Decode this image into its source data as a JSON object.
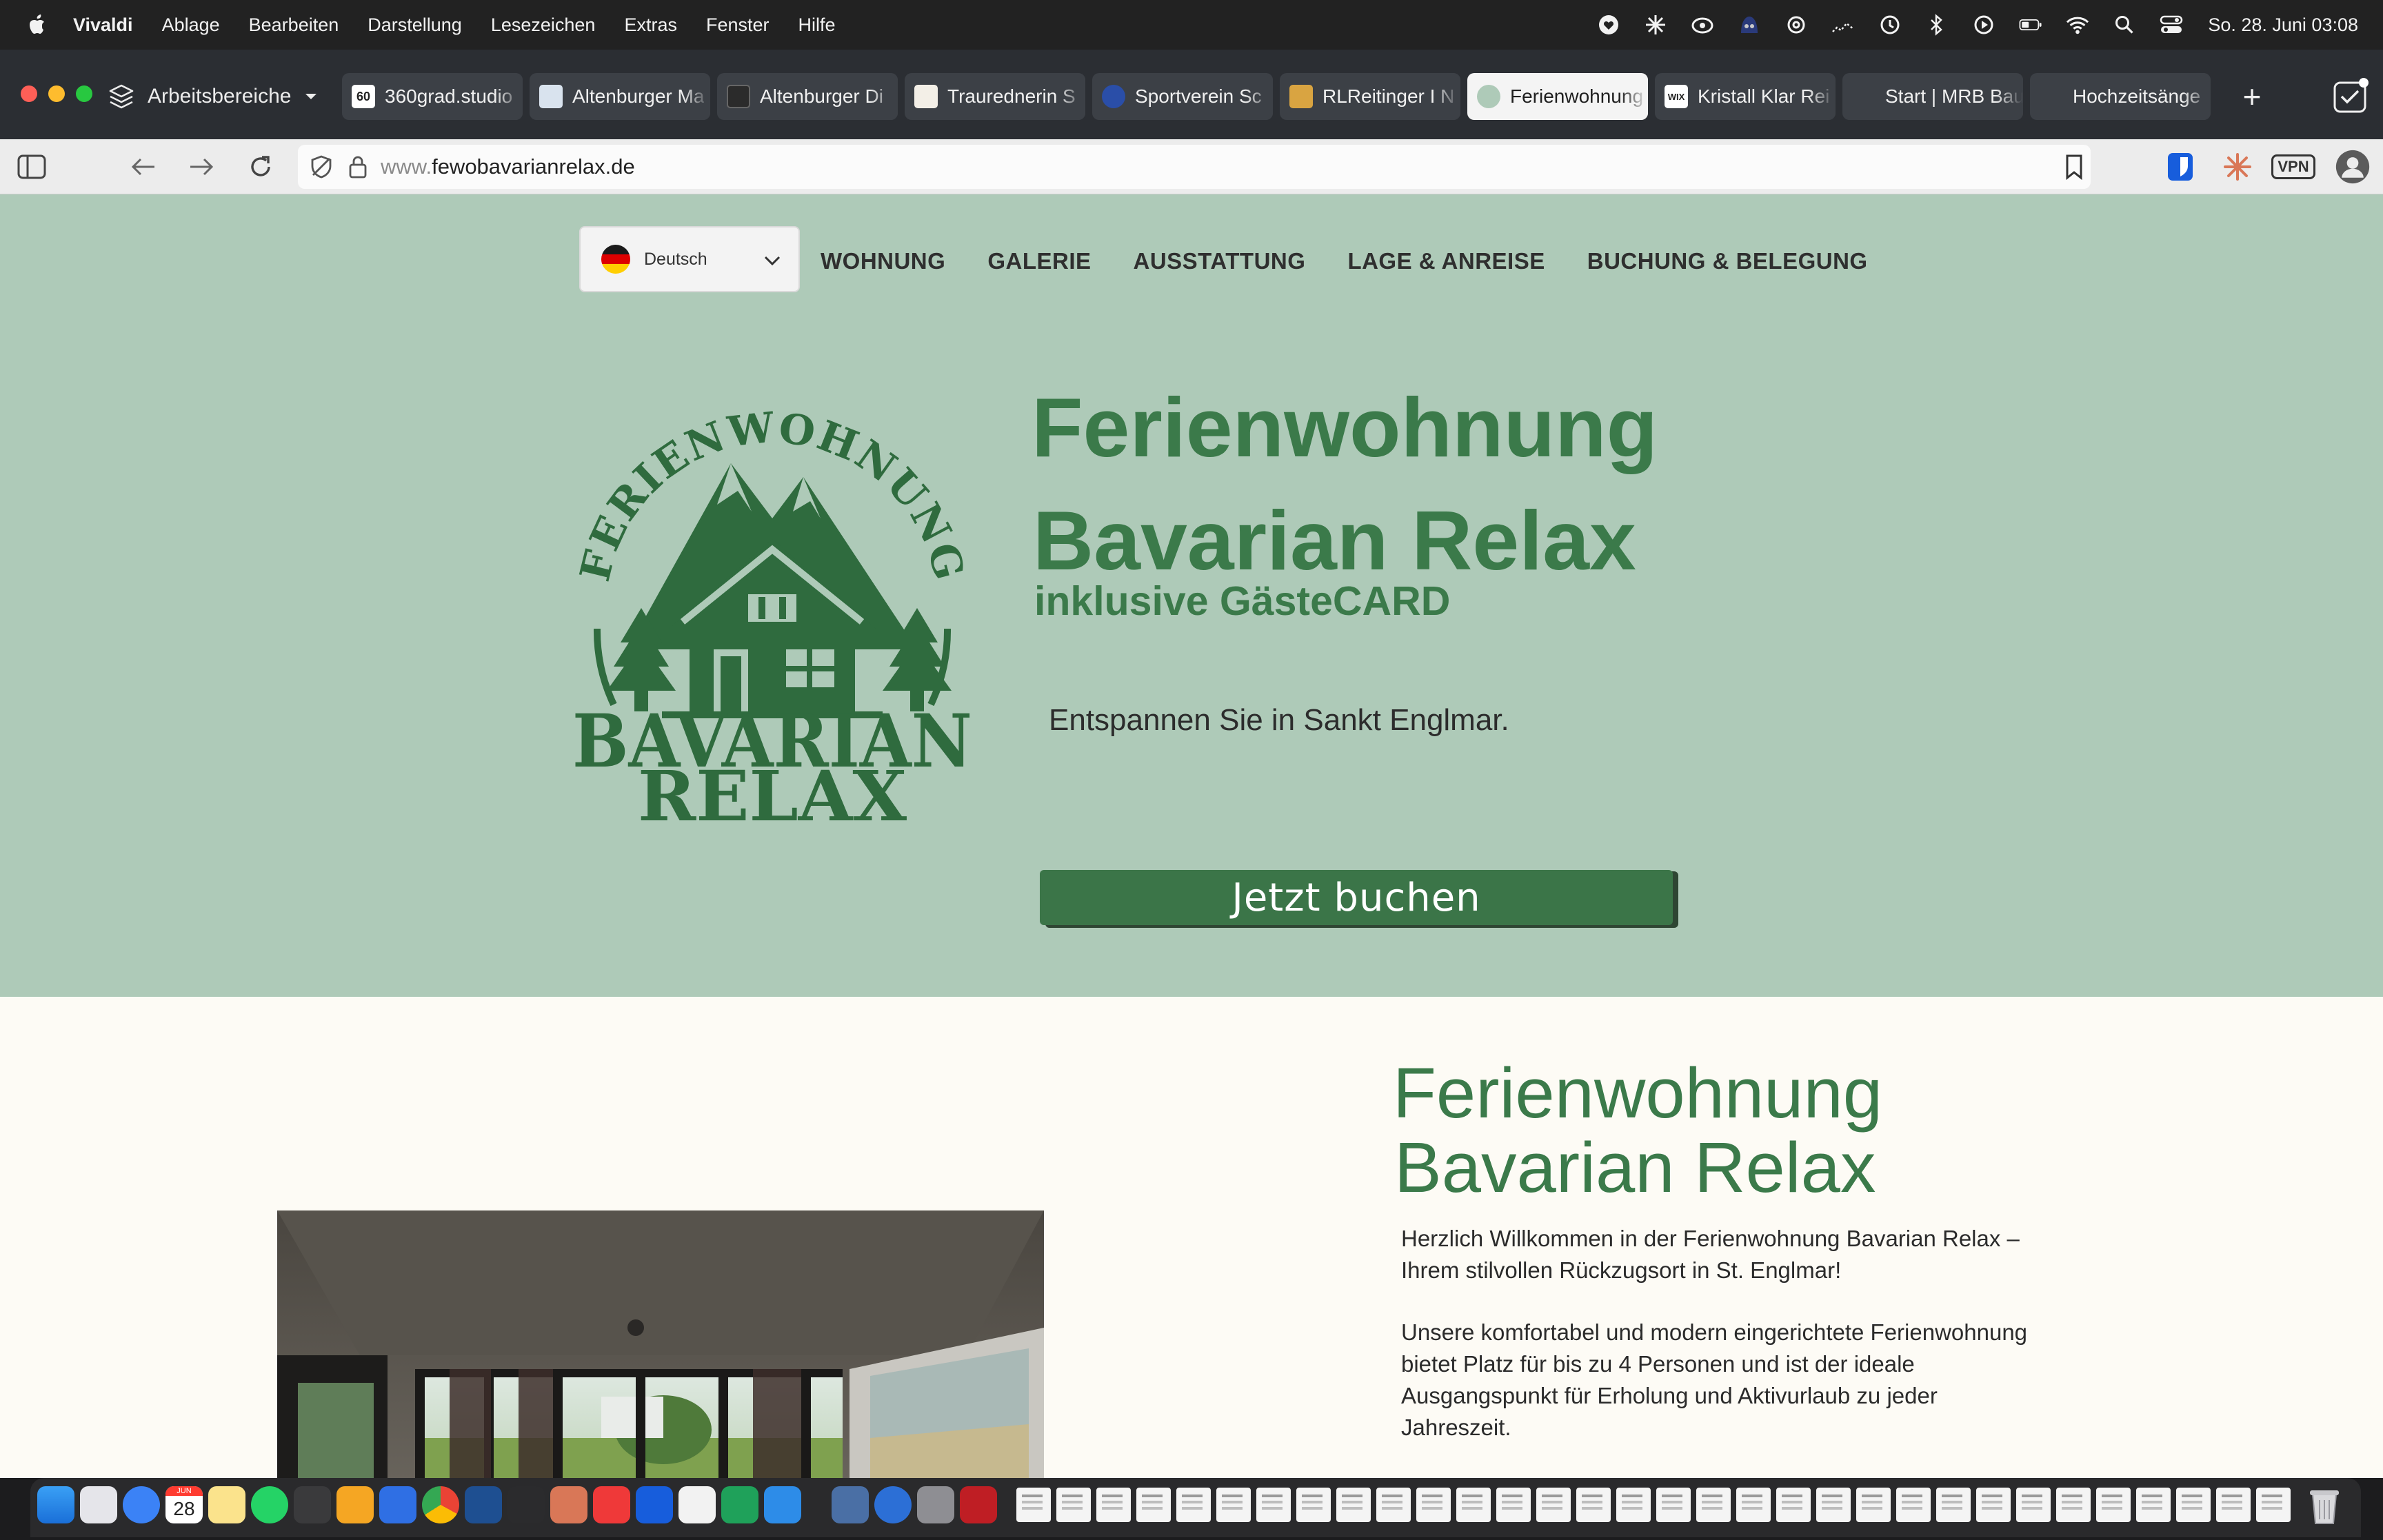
{
  "menubar": {
    "app": "Vivaldi",
    "items": [
      "Ablage",
      "Bearbeiten",
      "Darstellung",
      "Lesezeichen",
      "Extras",
      "Fenster",
      "Hilfe"
    ],
    "clock": "So. 28. Juni  03:08"
  },
  "browser": {
    "workspace_label": "Arbeitsbereiche",
    "tabs": [
      {
        "title": "360grad.studio",
        "favicon": "60",
        "color": "#ffffff"
      },
      {
        "title": "Altenburger Ma",
        "favicon": "",
        "color": "#d9e3ee"
      },
      {
        "title": "Altenburger Di",
        "favicon": "",
        "color": "#2b2b2b"
      },
      {
        "title": "Traurednerin S",
        "favicon": "",
        "color": "#f3efe7"
      },
      {
        "title": "Sportverein Sc",
        "favicon": "",
        "color": "#2a4ea8"
      },
      {
        "title": "RLReitinger I N",
        "favicon": "",
        "color": "#d9a441"
      },
      {
        "title": "Ferienwohnung",
        "favicon": "",
        "color": "#aecab8"
      },
      {
        "title": "Kristall Klar Rei",
        "favicon": "WIX",
        "color": "#ffffff"
      },
      {
        "title": "Start | MRB Bau",
        "favicon": "",
        "color": "#3c4046"
      },
      {
        "title": "Hochzeitsänge",
        "favicon": "",
        "color": "#3c4046"
      }
    ],
    "url_prefix": "www.",
    "url_host": "fewobavarianrelax.de",
    "vpn_label": "VPN"
  },
  "site": {
    "language": "Deutsch",
    "nav": [
      "WOHNUNG",
      "GALERIE",
      "AUSSTATTUNG",
      "LAGE & ANREISE",
      "BUCHUNG & BELEGUNG"
    ],
    "logo": {
      "arc": "FERIENWOHNUNG",
      "line1": "BAVARIAN",
      "line2": "RELAX"
    },
    "hero": {
      "title_line1": "Ferienwohnung",
      "title_line2": "Bavarian Relax",
      "subtitle": "inklusive GästeCARD",
      "tagline": "Entspannen Sie in Sankt Englmar.",
      "cta": "Jetzt buchen"
    },
    "intro": {
      "heading_line1": "Ferienwohnung",
      "heading_line2": "Bavarian Relax",
      "p1_line1": "Herzlich Willkommen in der Ferienwohnung Bavarian Relax –",
      "p1_line2": "Ihrem stilvollen Rückzugsort in St. Englmar!",
      "p2_line1": "Unsere komfortabel und modern eingerichtete Ferienwohnung",
      "p2_line2": "bietet Platz für bis zu 4 Personen und ist der ideale",
      "p2_line3": "Ausgangspunkt für Erholung und Aktivurlaub zu jeder",
      "p2_line4": "Jahreszeit."
    }
  },
  "dock": {
    "calendar_month": "JUN",
    "calendar_day": "28"
  },
  "colors": {
    "hero_bg": "#aecab8",
    "brand_green": "#3b7a4a",
    "cta_green": "#3b7548",
    "page_bg": "#fdfbf5"
  }
}
